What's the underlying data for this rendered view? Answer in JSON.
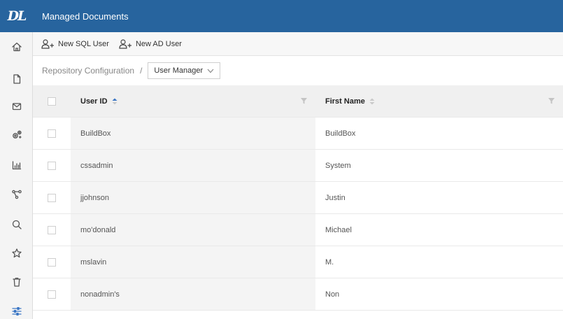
{
  "app": {
    "logo_text": "DL",
    "title": "Managed Documents"
  },
  "toolbar": {
    "new_sql_user": "New SQL User",
    "new_ad_user": "New AD User"
  },
  "breadcrumb": {
    "parent": "Repository Configuration",
    "separator": "/",
    "current": "User Manager"
  },
  "sidebar": {
    "icons": [
      "home-icon",
      "document-icon",
      "mail-icon",
      "settings-icon",
      "chart-icon",
      "workflow-icon",
      "search-icon",
      "star-icon",
      "trash-icon",
      "sliders-icon"
    ],
    "active": "sliders-icon"
  },
  "table": {
    "columns": [
      "User ID",
      "First Name"
    ],
    "rows": [
      {
        "user_id": "BuildBox",
        "first_name": "BuildBox"
      },
      {
        "user_id": "cssadmin",
        "first_name": "System"
      },
      {
        "user_id": "jjohnson",
        "first_name": "Justin"
      },
      {
        "user_id": "mo'donald",
        "first_name": "Michael"
      },
      {
        "user_id": "mslavin",
        "first_name": "M."
      },
      {
        "user_id": "nonadmin's",
        "first_name": "Non"
      }
    ]
  },
  "colors": {
    "header_blue": "#27649e",
    "accent_blue": "#3a76c4"
  }
}
